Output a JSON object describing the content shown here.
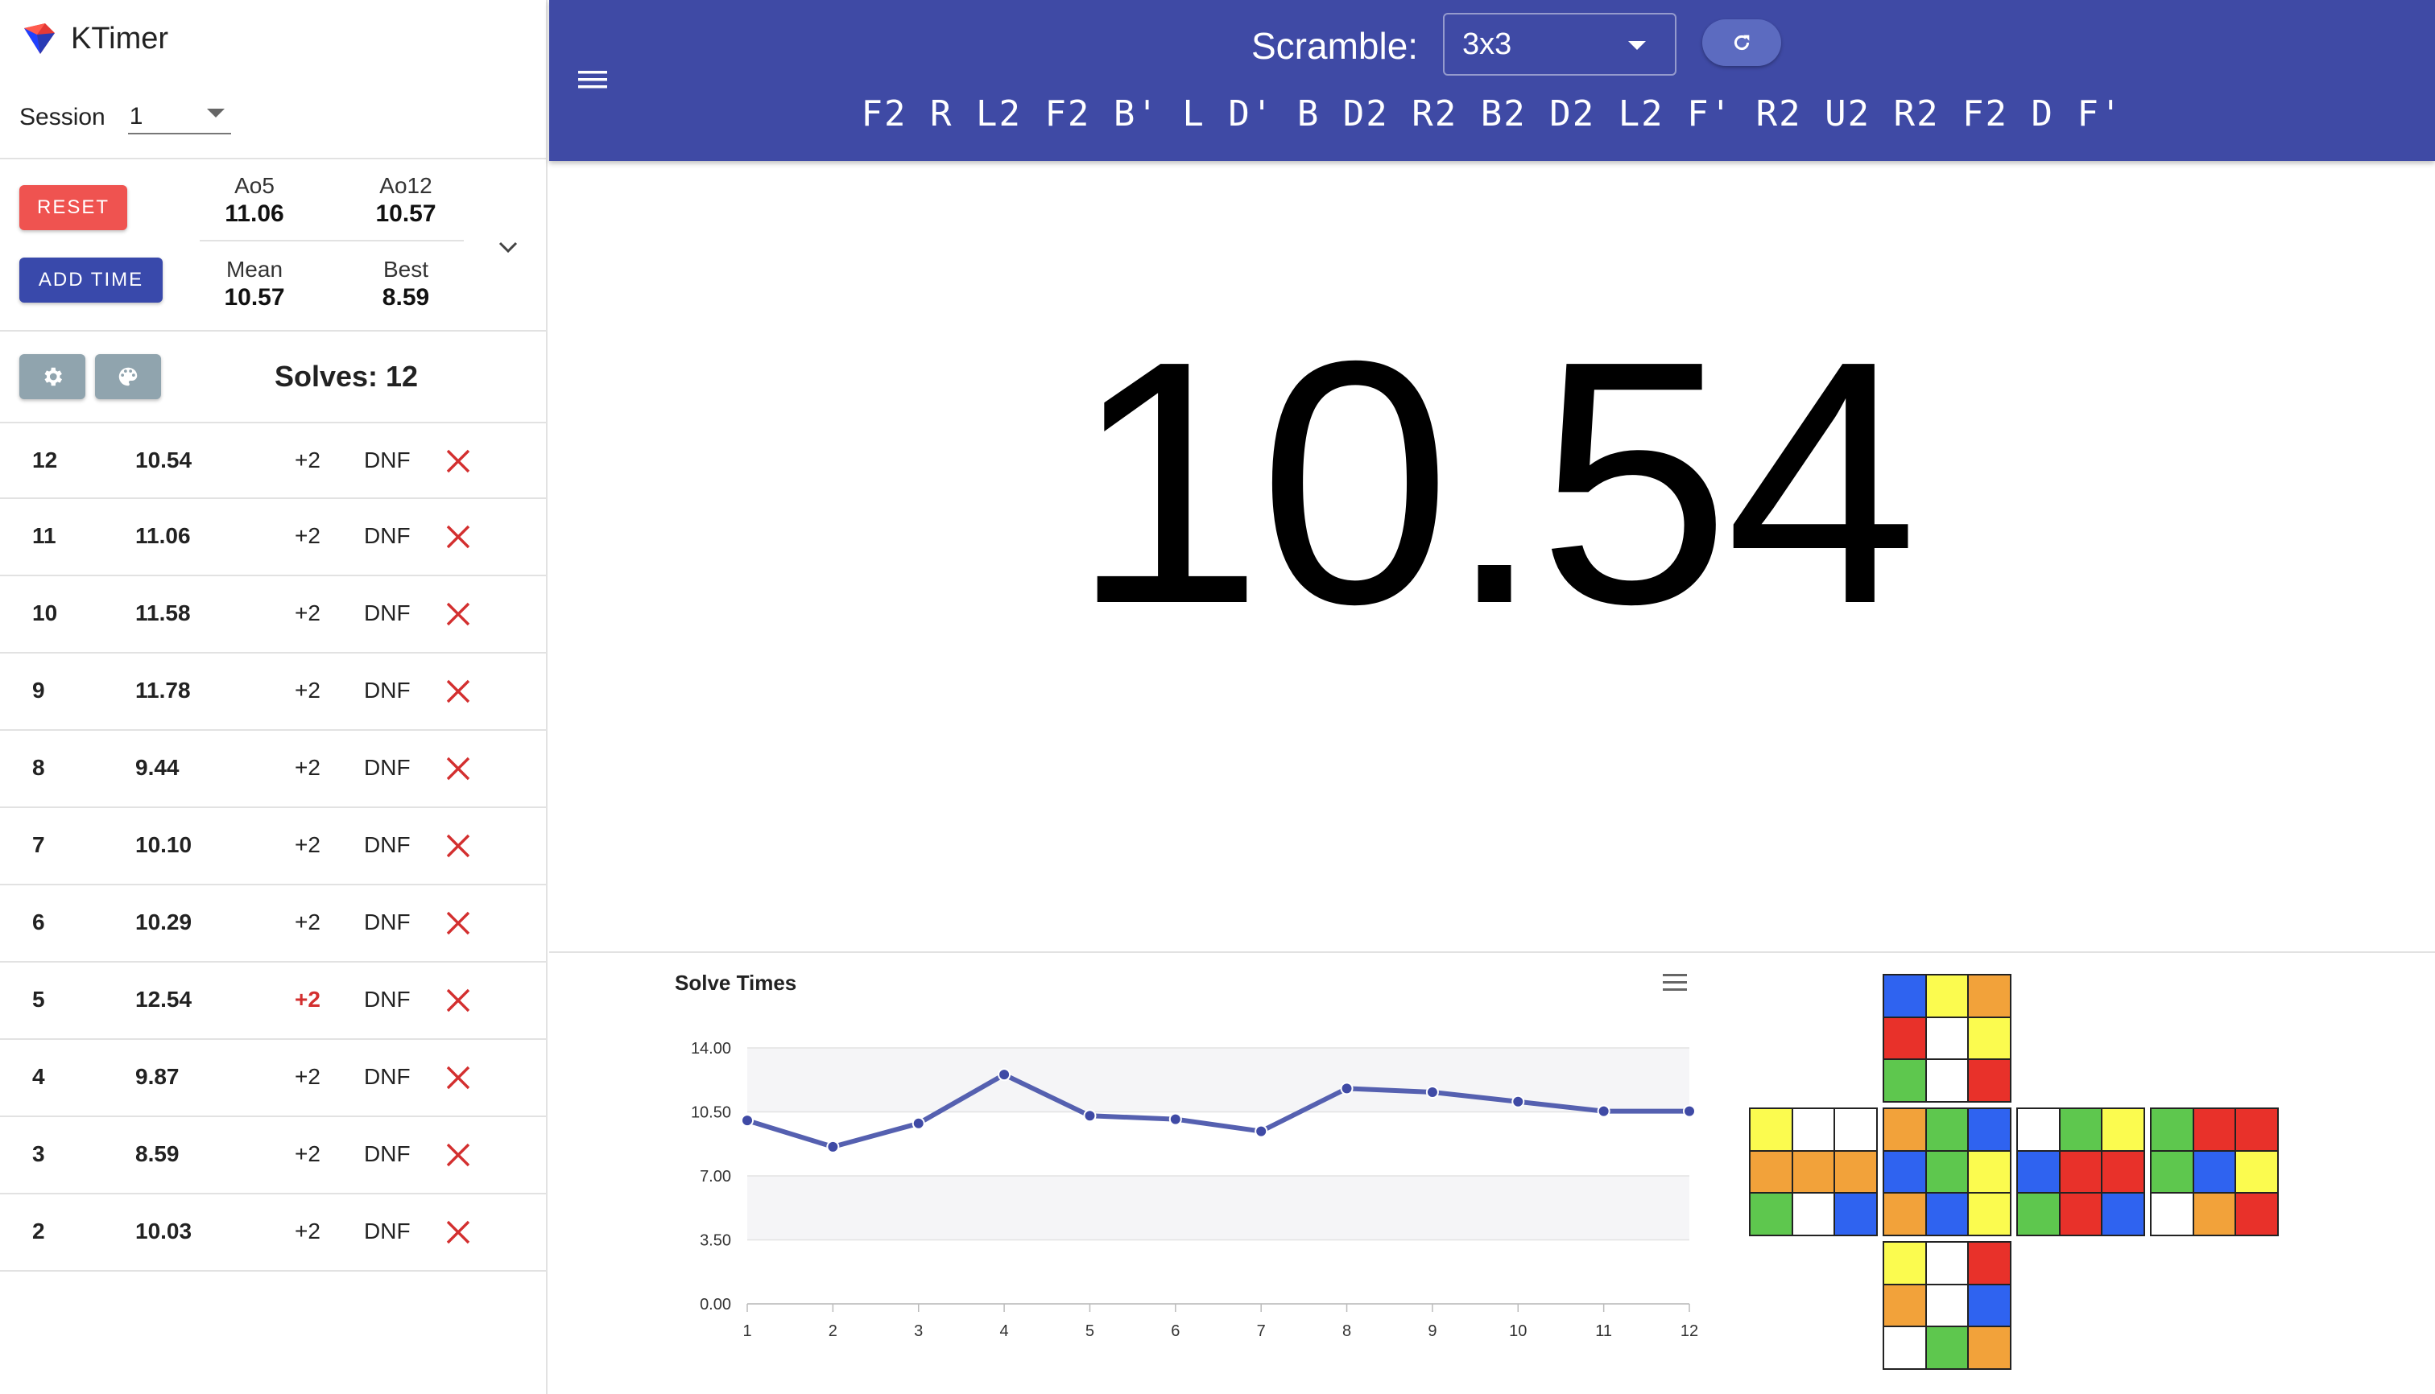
{
  "app": {
    "title": "KTimer"
  },
  "session": {
    "label": "Session",
    "value": "1"
  },
  "buttons": {
    "reset": "RESET",
    "add_time": "ADD TIME"
  },
  "stats": {
    "ao5_label": "Ao5",
    "ao5_value": "11.06",
    "ao12_label": "Ao12",
    "ao12_value": "10.57",
    "mean_label": "Mean",
    "mean_value": "10.57",
    "best_label": "Best",
    "best_value": "8.59"
  },
  "solves": {
    "count_text": "Solves: 12",
    "penalty_label": "+2",
    "dnf_label": "DNF",
    "rows": [
      {
        "num": "12",
        "time": "10.54",
        "plus2_active": false
      },
      {
        "num": "11",
        "time": "11.06",
        "plus2_active": false
      },
      {
        "num": "10",
        "time": "11.58",
        "plus2_active": false
      },
      {
        "num": "9",
        "time": "11.78",
        "plus2_active": false
      },
      {
        "num": "8",
        "time": "9.44",
        "plus2_active": false
      },
      {
        "num": "7",
        "time": "10.10",
        "plus2_active": false
      },
      {
        "num": "6",
        "time": "10.29",
        "plus2_active": false
      },
      {
        "num": "5",
        "time": "12.54",
        "plus2_active": true
      },
      {
        "num": "4",
        "time": "9.87",
        "plus2_active": false
      },
      {
        "num": "3",
        "time": "8.59",
        "plus2_active": false
      },
      {
        "num": "2",
        "time": "10.03",
        "plus2_active": false
      }
    ]
  },
  "header": {
    "scramble_label": "Scramble:",
    "puzzle_type": "3x3",
    "scramble": "F2 R L2 F2 B' L D' B D2 R2 B2 D2 L2 F' R2 U2 R2 F2 D F'"
  },
  "timer": {
    "display": "10.54"
  },
  "colors": {
    "header": "#3f4aa5",
    "reset": "#ef5350",
    "add_time": "#3949ab",
    "line": "#5560b0",
    "penalty_active": "#d32f2f",
    "delete": "#d32f2f",
    "icon_button": "#90a4ae"
  },
  "cube_colors": {
    "W": "#ffffff",
    "Y": "#fbfb4f",
    "R": "#e8312a",
    "O": "#f2a23a",
    "G": "#5ec74e",
    "B": "#2f63f0"
  },
  "cube_net": {
    "U": [
      "B",
      "Y",
      "O",
      "R",
      "W",
      "Y",
      "G",
      "W",
      "R"
    ],
    "L": [
      "Y",
      "W",
      "W",
      "O",
      "O",
      "O",
      "G",
      "W",
      "B"
    ],
    "F": [
      "O",
      "G",
      "B",
      "B",
      "G",
      "Y",
      "O",
      "B",
      "Y"
    ],
    "R": [
      "W",
      "G",
      "Y",
      "B",
      "R",
      "R",
      "G",
      "R",
      "B"
    ],
    "Bk": [
      "G",
      "R",
      "R",
      "G",
      "B",
      "Y",
      "W",
      "O",
      "R"
    ],
    "D": [
      "Y",
      "W",
      "R",
      "O",
      "W",
      "B",
      "W",
      "G",
      "O"
    ]
  },
  "chart_data": {
    "type": "line",
    "title": "Solve Times",
    "x": [
      1,
      2,
      3,
      4,
      5,
      6,
      7,
      8,
      9,
      10,
      11,
      12
    ],
    "series": [
      {
        "values": [
          10.03,
          8.59,
          9.87,
          12.54,
          10.29,
          10.1,
          9.44,
          11.78,
          11.58,
          11.06,
          10.54,
          10.54
        ]
      }
    ],
    "y_ticks": [
      "0.00",
      "3.50",
      "7.00",
      "10.50",
      "14.00"
    ],
    "ylim": [
      0,
      14
    ],
    "xlabel": "",
    "ylabel": "",
    "grid": "horizontal bands"
  }
}
